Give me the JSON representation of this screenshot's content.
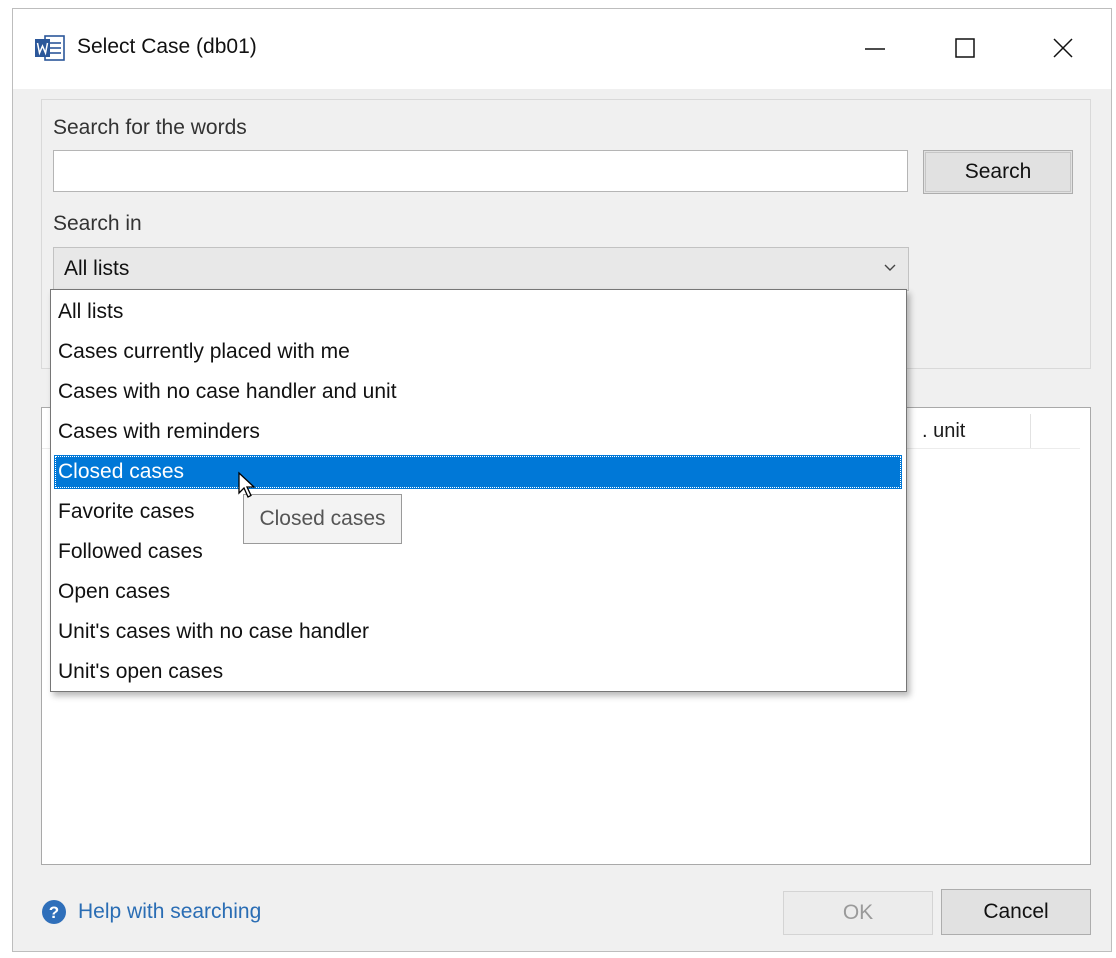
{
  "window": {
    "title": "Select Case (db01)",
    "app_icon": "word-icon",
    "controls": [
      "minimize-icon",
      "maximize-icon",
      "close-icon"
    ]
  },
  "search": {
    "label": "Search for the words",
    "input_value": "",
    "button_label": "Search"
  },
  "search_in": {
    "label": "Search in",
    "selected": "All lists",
    "options": [
      "All lists",
      "Cases currently placed with me",
      "Cases with no case handler and unit",
      "Cases with reminders",
      "Closed cases",
      "Favorite cases",
      "Followed cases",
      "Open cases",
      "Unit's cases with no case handler",
      "Unit's open cases"
    ],
    "highlighted": "Closed cases",
    "tooltip": "Closed cases"
  },
  "results": {
    "visible_header": ". unit"
  },
  "footer": {
    "help_label": "Help with searching",
    "help_icon": "help-icon",
    "ok_label": "OK",
    "cancel_label": "Cancel"
  },
  "colors": {
    "highlight": "#0078d7",
    "link": "#2a6db4",
    "disabled_text": "#9a9a9a"
  }
}
